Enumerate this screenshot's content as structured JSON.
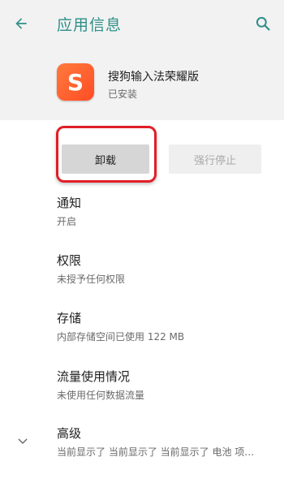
{
  "appbar": {
    "title": "应用信息",
    "back_icon": "arrow-left-icon",
    "search_icon": "search-icon"
  },
  "app": {
    "name": "搜狗输入法荣耀版",
    "status": "已安装",
    "icon": "sogou-s-icon",
    "icon_letter": "S"
  },
  "buttons": {
    "uninstall_label": "卸载",
    "force_stop_label": "强行停止"
  },
  "settings": [
    {
      "title": "通知",
      "subtitle": "开启"
    },
    {
      "title": "权限",
      "subtitle": "未授予任何权限"
    },
    {
      "title": "存储",
      "subtitle": "内部存储空间已使用 122 MB"
    },
    {
      "title": "流量使用情况",
      "subtitle": "未使用任何数据流量"
    },
    {
      "title": "高级",
      "subtitle": "当前显示了 当前显示了 当前显示了 电池 项…"
    }
  ],
  "colors": {
    "accent": "#2e8f88",
    "highlight": "#e11e26",
    "app_icon": "#ff5a2a"
  }
}
